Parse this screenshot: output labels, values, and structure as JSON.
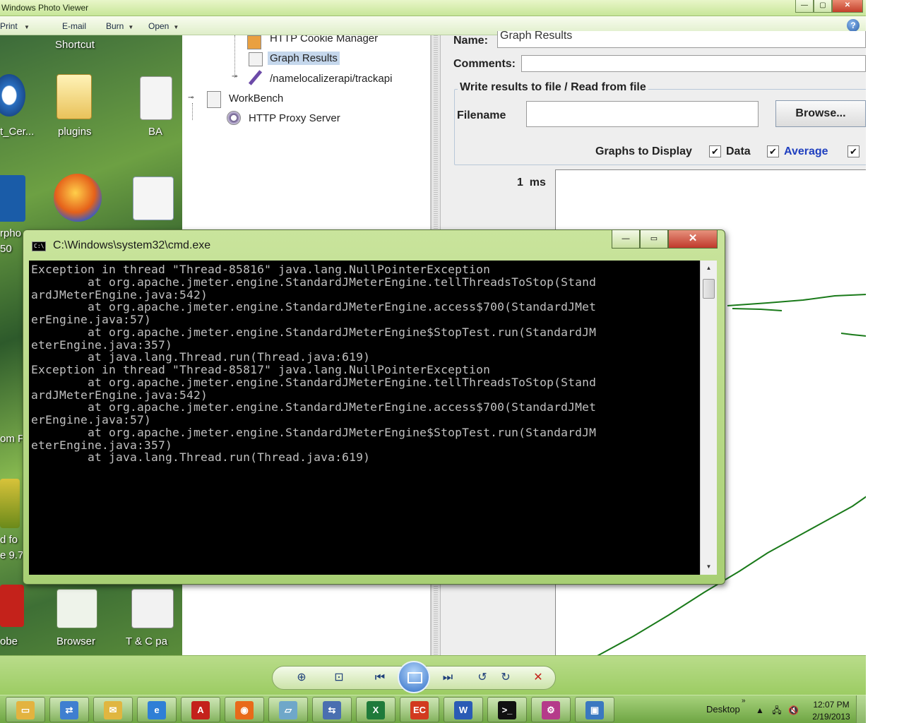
{
  "photo_viewer": {
    "title": "Windows Photo Viewer",
    "menu": [
      {
        "label": "Print"
      },
      {
        "label": "E-mail"
      },
      {
        "label": "Burn"
      },
      {
        "label": "Open"
      }
    ],
    "help_glyph": "?"
  },
  "desktop": {
    "icons": [
      {
        "label": "Shortcut"
      },
      {
        "label": "t_Cer..."
      },
      {
        "label": "plugins"
      },
      {
        "label": "BA"
      },
      {
        "label": "rpho"
      },
      {
        "label": "50"
      },
      {
        "label": "om F"
      },
      {
        "label": "d fo"
      },
      {
        "label": "e 9.7"
      },
      {
        "label": "obe"
      },
      {
        "label": "Browser"
      },
      {
        "label": "T & C pa"
      }
    ]
  },
  "jmeter": {
    "tree": [
      {
        "label": "HTTP Cookie Manager",
        "icon": "cookie-icon"
      },
      {
        "label": "Graph Results",
        "icon": "graph-icon",
        "selected": true
      },
      {
        "label": "/namelocalizerapi/trackapi",
        "icon": "sampler-icon"
      },
      {
        "label": "WorkBench",
        "icon": "workbench-icon"
      },
      {
        "label": "HTTP Proxy Server",
        "icon": "proxy-icon"
      }
    ],
    "panel": {
      "name_label": "Name:",
      "name_value": "Graph Results",
      "comments_label": "Comments:",
      "write_legend": "Write results to file / Read from file",
      "filename_label": "Filename",
      "filename_value": "",
      "browse_label": "Browse...",
      "graphs_to_display_label": "Graphs to Display",
      "checkboxes": [
        {
          "label": "Data",
          "checked": true
        },
        {
          "label": "Average",
          "checked": true
        },
        {
          "label": "",
          "checked": true
        }
      ],
      "y_axis_label": "1  ms",
      "average_color": "#1f3fbf",
      "plot_color": "#1a7a1a"
    }
  },
  "cmd": {
    "title": "C:\\Windows\\system32\\cmd.exe",
    "lines": [
      "Exception in thread \"Thread-85816\" java.lang.NullPointerException",
      "        at org.apache.jmeter.engine.StandardJMeterEngine.tellThreadsToStop(Stand",
      "ardJMeterEngine.java:542)",
      "        at org.apache.jmeter.engine.StandardJMeterEngine.access$700(StandardJMet",
      "erEngine.java:57)",
      "        at org.apache.jmeter.engine.StandardJMeterEngine$StopTest.run(StandardJM",
      "eterEngine.java:357)",
      "        at java.lang.Thread.run(Thread.java:619)",
      "Exception in thread \"Thread-85817\" java.lang.NullPointerException",
      "        at org.apache.jmeter.engine.StandardJMeterEngine.tellThreadsToStop(Stand",
      "ardJMeterEngine.java:542)",
      "        at org.apache.jmeter.engine.StandardJMeterEngine.access$700(StandardJMet",
      "erEngine.java:57)",
      "        at org.apache.jmeter.engine.StandardJMeterEngine$StopTest.run(StandardJM",
      "eterEngine.java:357)",
      "        at java.lang.Thread.run(Thread.java:619)"
    ],
    "console_bg": "#000000",
    "console_fg": "#c0c0c0"
  },
  "viewer_controls": [
    {
      "name": "zoom-icon",
      "glyph": "⊕"
    },
    {
      "name": "actual-size-icon",
      "glyph": "⊡"
    },
    {
      "name": "previous-icon",
      "glyph": "⏮"
    },
    {
      "name": "next-icon",
      "glyph": "⏭"
    },
    {
      "name": "rotate-ccw-icon",
      "glyph": "↺"
    },
    {
      "name": "rotate-cw-icon",
      "glyph": "↻"
    },
    {
      "name": "delete-icon",
      "glyph": "✕"
    }
  ],
  "taskbar": {
    "apps": [
      {
        "name": "explorer",
        "color": "#e3b33f"
      },
      {
        "name": "network",
        "color": "#3f7fd0"
      },
      {
        "name": "outlook",
        "color": "#e0b640"
      },
      {
        "name": "internet-explorer",
        "color": "#2f7fd6"
      },
      {
        "name": "acrobat",
        "color": "#c4221b"
      },
      {
        "name": "firefox",
        "color": "#e86a1a"
      },
      {
        "name": "app",
        "color": "#6fa7c9"
      },
      {
        "name": "remote",
        "color": "#4a6fb0"
      },
      {
        "name": "excel",
        "color": "#1f7a3a"
      },
      {
        "name": "eclipse",
        "color": "#d23a1f"
      },
      {
        "name": "word",
        "color": "#2a5bb5"
      },
      {
        "name": "cmd",
        "color": "#111111"
      },
      {
        "name": "jmeter",
        "color": "#b53a8a"
      },
      {
        "name": "photo-viewer",
        "color": "#3a78c0"
      }
    ],
    "desktop_label": "Desktop",
    "time": "12:07 PM",
    "date": "2/19/2013"
  }
}
